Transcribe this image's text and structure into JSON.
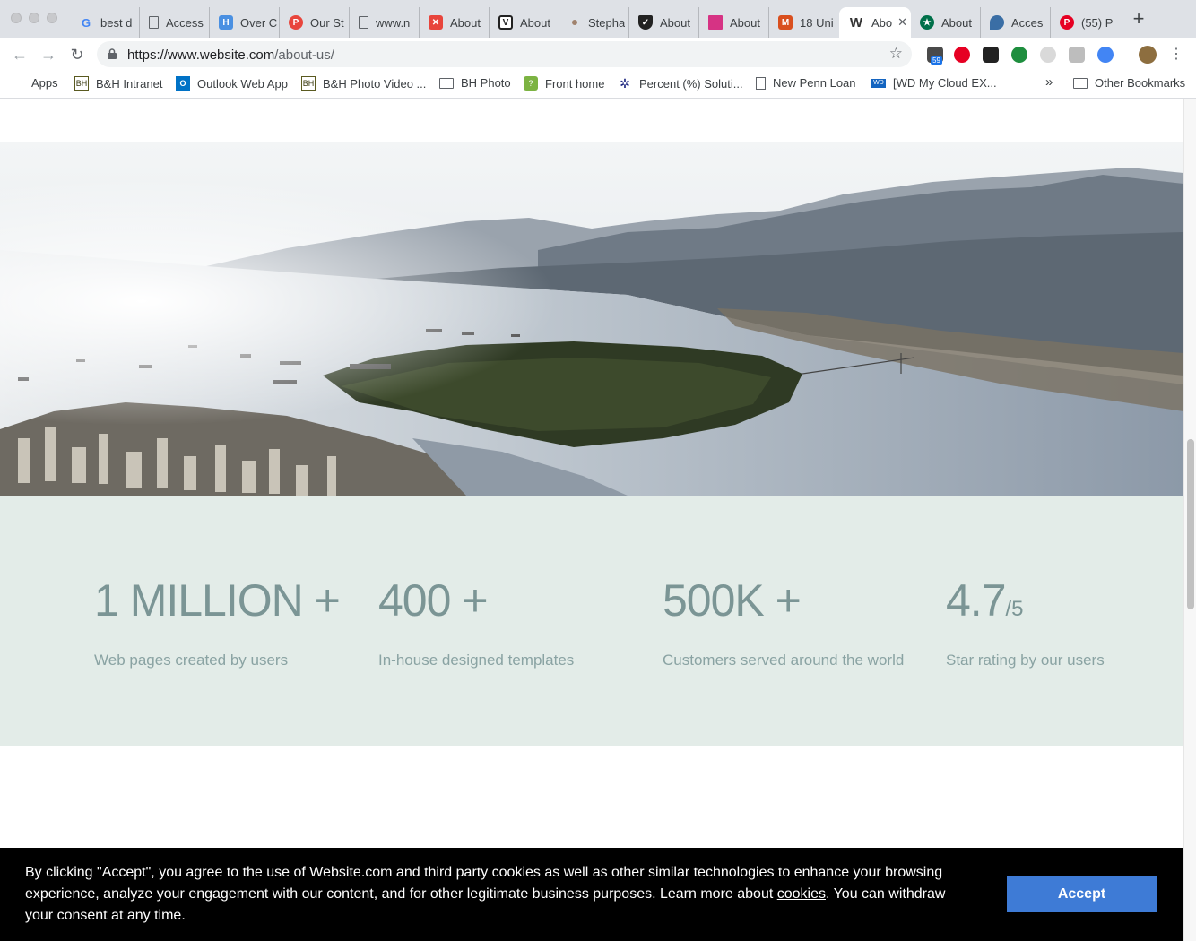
{
  "browser": {
    "tabs": [
      {
        "title": "best d",
        "icon": "google-icon",
        "color": "#4285f4"
      },
      {
        "title": "Access",
        "icon": "document-icon",
        "color": "#5f6368"
      },
      {
        "title": "Over C",
        "icon": "h-icon",
        "color": "#4a90e2"
      },
      {
        "title": "Our St",
        "icon": "podia-icon",
        "color": "#e8453c"
      },
      {
        "title": "www.n",
        "icon": "document-icon",
        "color": "#5f6368"
      },
      {
        "title": "About",
        "icon": "red-logo-icon",
        "color": "#e8453c"
      },
      {
        "title": "About",
        "icon": "v-icon",
        "color": "#222222"
      },
      {
        "title": "Stepha",
        "icon": "square-icon",
        "color": "#a0826d"
      },
      {
        "title": "About",
        "icon": "shield-logo-icon",
        "color": "#222222"
      },
      {
        "title": "About",
        "icon": "pink-square-icon",
        "color": "#d63384"
      },
      {
        "title": "18 Uni",
        "icon": "m-icon",
        "color": "#d94f1e"
      },
      {
        "title": "Abo",
        "icon": "w-icon",
        "color": "#333333",
        "active": true
      },
      {
        "title": "About",
        "icon": "starbucks-icon",
        "color": "#00704a"
      },
      {
        "title": "Acces",
        "icon": "bird-icon",
        "color": "#3a6ea5"
      },
      {
        "title": "(55) P",
        "icon": "pinterest-icon",
        "color": "#e60023"
      }
    ],
    "url_host": "https://www.website.com",
    "url_path": "/about-us/",
    "extension_badge": "59",
    "bookmarks": [
      {
        "label": "Apps",
        "icon": "apps-grid-icon"
      },
      {
        "label": "B&H Intranet",
        "icon": "bh-icon"
      },
      {
        "label": "Outlook Web App",
        "icon": "outlook-icon"
      },
      {
        "label": "B&H Photo Video ...",
        "icon": "bh-icon"
      },
      {
        "label": "BH Photo",
        "icon": "folder-icon"
      },
      {
        "label": "Front home",
        "icon": "front-icon"
      },
      {
        "label": "Percent (%) Soluti...",
        "icon": "percent-icon"
      },
      {
        "label": "New Penn Loan",
        "icon": "document-icon"
      },
      {
        "label": "[WD My Cloud EX...",
        "icon": "wd-icon"
      }
    ],
    "overflow_label": "»",
    "other_bookmarks": "Other Bookmarks"
  },
  "stats": [
    {
      "value": "1 MILLION +",
      "suffix": "",
      "label": "Web pages created by users"
    },
    {
      "value": "400 +",
      "suffix": "",
      "label": "In-house designed templates"
    },
    {
      "value": "500K +",
      "suffix": "",
      "label": "Customers served around the world"
    },
    {
      "value": "4.7",
      "suffix": "/5",
      "label": "Star rating by our users"
    }
  ],
  "cookie": {
    "text_before": "By clicking \"Accept\", you agree to the use of Website.com and third party cookies as well as other similar technologies to enhance your browsing experience, analyze your engagement with our content, and for other legitimate business purposes. Learn more about ",
    "link": "cookies",
    "text_after": ". You can withdraw your consent at any time.",
    "accept_label": "Accept"
  },
  "colors": {
    "stats_bg": "#e3ece8",
    "stats_text": "#7b9595",
    "accept_button": "#3e7bd6",
    "banner_bg": "#000000"
  }
}
